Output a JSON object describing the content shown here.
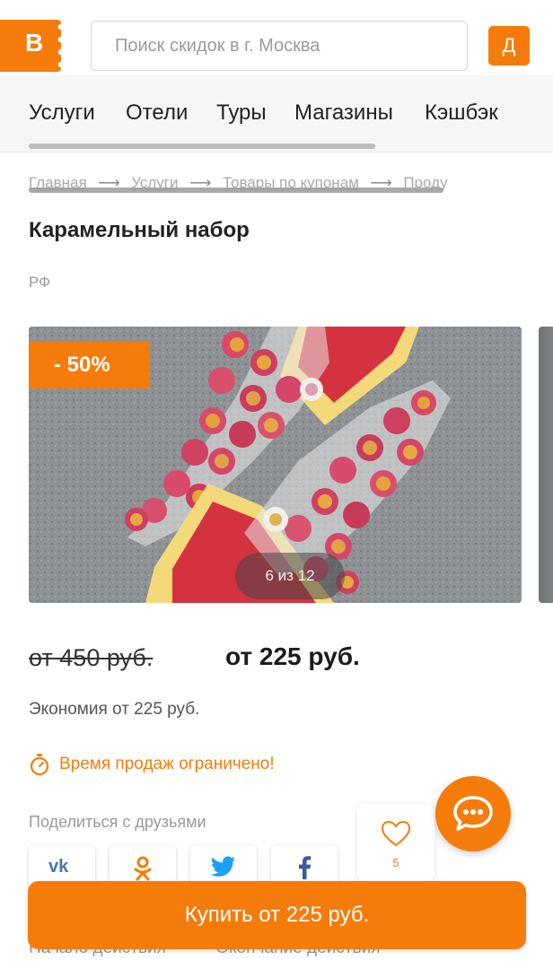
{
  "header": {
    "logo_letter": "B",
    "search_placeholder": "Поиск скидок в г. Москва",
    "user_initial": "Д"
  },
  "nav": {
    "items": [
      {
        "label": "Услуги"
      },
      {
        "label": "Отели"
      },
      {
        "label": "Туры"
      },
      {
        "label": "Магазины"
      },
      {
        "label": "Кэшбэк"
      }
    ]
  },
  "breadcrumbs": {
    "items": [
      {
        "label": "Главная"
      },
      {
        "label": "Услуги"
      },
      {
        "label": "Товары по купонам"
      },
      {
        "label": "Проду"
      }
    ]
  },
  "product": {
    "title": "Карамельный набор",
    "region": "РФ",
    "discount": "- 50%",
    "photo_counter": "6 из 12",
    "old_price": "от 450 руб.",
    "new_price": "от 225 руб.",
    "savings": "Экономия от 225 руб.",
    "time_limited": "Время продаж ограничено!"
  },
  "share": {
    "label": "Поделиться с друзьями",
    "networks": [
      {
        "name": "vk",
        "icon": "vk-icon"
      },
      {
        "name": "odnoklassniki",
        "icon": "ok-icon"
      },
      {
        "name": "twitter",
        "icon": "twitter-icon"
      },
      {
        "name": "facebook",
        "icon": "facebook-icon"
      }
    ]
  },
  "likes": {
    "count": "5"
  },
  "buy_button": {
    "label": "Купить от 225 руб."
  },
  "dates": {
    "start_label": "Начало действия",
    "end_label": "Окончание действия"
  },
  "colors": {
    "accent": "#f57c0b",
    "vk": "#4a76a8",
    "twitter": "#1da1f2",
    "facebook": "#3b5998"
  }
}
